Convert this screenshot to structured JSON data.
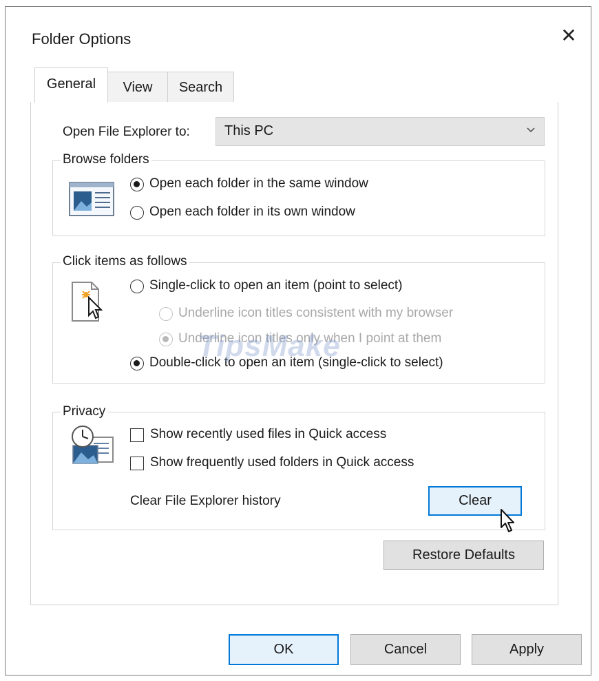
{
  "window": {
    "title": "Folder Options",
    "close_icon": "close-icon"
  },
  "tabs": [
    {
      "label": "General",
      "selected": true
    },
    {
      "label": "View",
      "selected": false
    },
    {
      "label": "Search",
      "selected": false
    }
  ],
  "general": {
    "open_explorer_label": "Open File Explorer to:",
    "open_explorer_value": "This PC",
    "browse_folders": {
      "title": "Browse folders",
      "icon": "window-icon",
      "options": [
        {
          "label": "Open each folder in the same window",
          "checked": true
        },
        {
          "label": "Open each folder in its own window",
          "checked": false
        }
      ]
    },
    "click_items": {
      "title": "Click items as follows",
      "icon": "pointer-click-icon",
      "single_click": {
        "label": "Single-click to open an item (point to select)",
        "checked": false
      },
      "sub_options": [
        {
          "label": "Underline icon titles consistent with my browser",
          "checked": false,
          "disabled": true
        },
        {
          "label": "Underline icon titles only when I point at them",
          "checked": true,
          "disabled": true
        }
      ],
      "double_click": {
        "label": "Double-click to open an item (single-click to select)",
        "checked": true
      }
    },
    "privacy": {
      "title": "Privacy",
      "icon": "clock-files-icon",
      "checkboxes": [
        {
          "label": "Show recently used files in Quick access",
          "checked": false
        },
        {
          "label": "Show frequently used folders in Quick access",
          "checked": false
        }
      ],
      "clear_history_label": "Clear File Explorer history",
      "clear_button": "Clear"
    },
    "restore_defaults": "Restore Defaults"
  },
  "footer": {
    "ok": "OK",
    "cancel": "Cancel",
    "apply": "Apply"
  },
  "watermark": "TipsMake",
  "colors": {
    "focus_border": "#0078d7",
    "button_bg": "#e1e1e1",
    "dropdown_bg": "#e5e5e5"
  }
}
